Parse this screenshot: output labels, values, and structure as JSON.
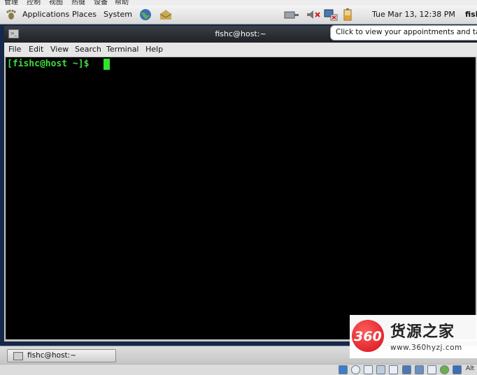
{
  "host_menu": {
    "items": [
      "管理",
      "控制",
      "视图",
      "热键",
      "设备",
      "帮助"
    ]
  },
  "top_panel": {
    "applications": "Applications",
    "places": "Places",
    "system": "System",
    "clock": "Tue Mar 13, 12:38 PM",
    "user": "fishc",
    "icons": [
      "applications-foot-icon",
      "web-browser-globe-icon",
      "mail-client-icon",
      "network-icon",
      "volume-muted-icon",
      "package-updates-icon",
      "battery-icon"
    ]
  },
  "tooltip": {
    "text": "Click to view your appointments and tasks"
  },
  "terminal": {
    "title": "fishc@host:~",
    "menu": [
      "File",
      "Edit",
      "View",
      "Search",
      "Terminal",
      "Help"
    ],
    "prompt": "[fishc@host ~]$ "
  },
  "bottom_panel": {
    "task": "fishc@host:~"
  },
  "vm_status": {
    "host_key": "Alt"
  },
  "watermark": {
    "logo": "360",
    "name": "货源之家",
    "url": "www.360hyzj.com"
  },
  "colors": {
    "terminal_background": "#000000",
    "prompt_green": "#3ddc3d",
    "desktop": "#152849"
  }
}
